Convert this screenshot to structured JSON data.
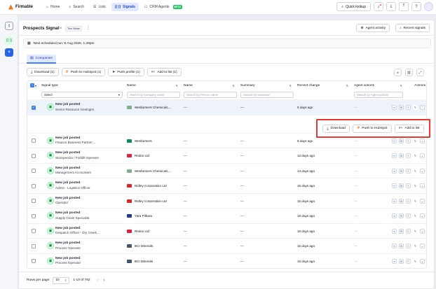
{
  "app": {
    "name": "Firmable"
  },
  "nav": [
    {
      "label": "Home",
      "icon": "home-icon"
    },
    {
      "label": "Search",
      "icon": "search-icon"
    },
    {
      "label": "Lists",
      "icon": "list-icon"
    },
    {
      "label": "Signals",
      "icon": "signal-icon",
      "active": true
    },
    {
      "label": "CRM Agents",
      "icon": "robot-icon",
      "badge": "BETA"
    }
  ],
  "topright": {
    "quick_lookup": "Quick lookup"
  },
  "page": {
    "title": "Prospects Signal",
    "meta": "6/6",
    "owner_tag": "Tom Nolan",
    "agent_activity": "Agent activity",
    "recent_signals": "Recent signals",
    "schedule": "Next scheduled run: 6 Aug 2026, 1:29pm"
  },
  "tabs": [
    {
      "label": "Companies"
    }
  ],
  "toolbar": {
    "download": "Download (1)",
    "push_hubspot": "Push to HubSpot (1)",
    "push_profile": "Push profile (1)",
    "add_to_list": "Add to list (1)"
  },
  "table": {
    "columns": {
      "signal_type": "Signal type",
      "name": "Name",
      "name2": "Name",
      "summary": "Summary",
      "recent_change": "Recent change",
      "agent_actions": "Agent actions",
      "actions": "Actions"
    },
    "filters": {
      "select": "Select",
      "company": "Search by Company name",
      "person": "Search by Person name",
      "summary": "Search by Summary",
      "agent": "Search by Agent actions"
    },
    "rows": [
      {
        "signal": "New job posted",
        "role": "Senior Resource Geologist",
        "company": "Wesfarmers Chemicals,...",
        "logo": "#7fae8f",
        "person": "—",
        "summary": "—",
        "change": "9 days ago",
        "agent": "—",
        "selected": true
      },
      {
        "signal": "New job posted",
        "role": "Finance Business Partner,...",
        "company": "Wesfarmers",
        "logo": "#0e8a5f",
        "person": "—",
        "summary": "—",
        "change": "9 days ago",
        "agent": "—",
        "selected": false
      },
      {
        "signal": "New job posted",
        "role": "Storeperson / Forklift Operator",
        "company": "Redox Ltd",
        "logo": "#e11d48",
        "person": "—",
        "summary": "—",
        "change": "12 days ago",
        "agent": "—",
        "selected": false
      },
      {
        "signal": "New job posted",
        "role": "Management Accountant",
        "company": "Wesfarmers Chemicals,...",
        "logo": "#7fae8f",
        "person": "—",
        "summary": "—",
        "change": "14 days ago",
        "agent": "—",
        "selected": false
      },
      {
        "signal": "New job posted",
        "role": "Admin - Logistics Officer",
        "company": "Ridley Corporation Ltd",
        "logo": "#dc2626",
        "person": "—",
        "summary": "—",
        "change": "15 days ago",
        "agent": "—",
        "selected": false
      },
      {
        "signal": "New job posted",
        "role": "Operator",
        "company": "Ridley Corporation Ltd",
        "logo": "#dc2626",
        "person": "—",
        "summary": "—",
        "change": "15 days ago",
        "agent": "—",
        "selected": false
      },
      {
        "signal": "New job posted",
        "role": "Supply Chain Specialist",
        "company": "Yara Pilbara",
        "logo": "#1e3a8a",
        "person": "—",
        "summary": "—",
        "change": "15 days ago",
        "agent": "—",
        "selected": false
      },
      {
        "signal": "New job posted",
        "role": "Despatch Officer - Dry Creek,...",
        "company": "Redox Ltd",
        "logo": "#e11d48",
        "person": "—",
        "summary": "—",
        "change": "15 days ago",
        "agent": "—",
        "selected": false
      },
      {
        "signal": "New job posted",
        "role": "Process Operator",
        "company": "BCI Minerals",
        "logo": "#475569",
        "person": "—",
        "summary": "—",
        "change": "15 days ago",
        "agent": "—",
        "selected": false
      },
      {
        "signal": "New job posted",
        "role": "Process Operator",
        "company": "BCI Minerals",
        "logo": "#475569",
        "person": "—",
        "summary": "—",
        "change": "16 days ago",
        "agent": "—",
        "selected": false
      }
    ]
  },
  "row_actions": {
    "download": "Download",
    "push_hubspot": "Push to HubSpot",
    "add_to_list": "Add to list"
  },
  "pagination": {
    "rows_per_page_label": "Rows per page",
    "rows_per_page": "10",
    "range": "1-10 of 762"
  },
  "colors": {
    "accent": "#3b82f6",
    "highlight": "#e53935",
    "brand": "#f97316"
  }
}
